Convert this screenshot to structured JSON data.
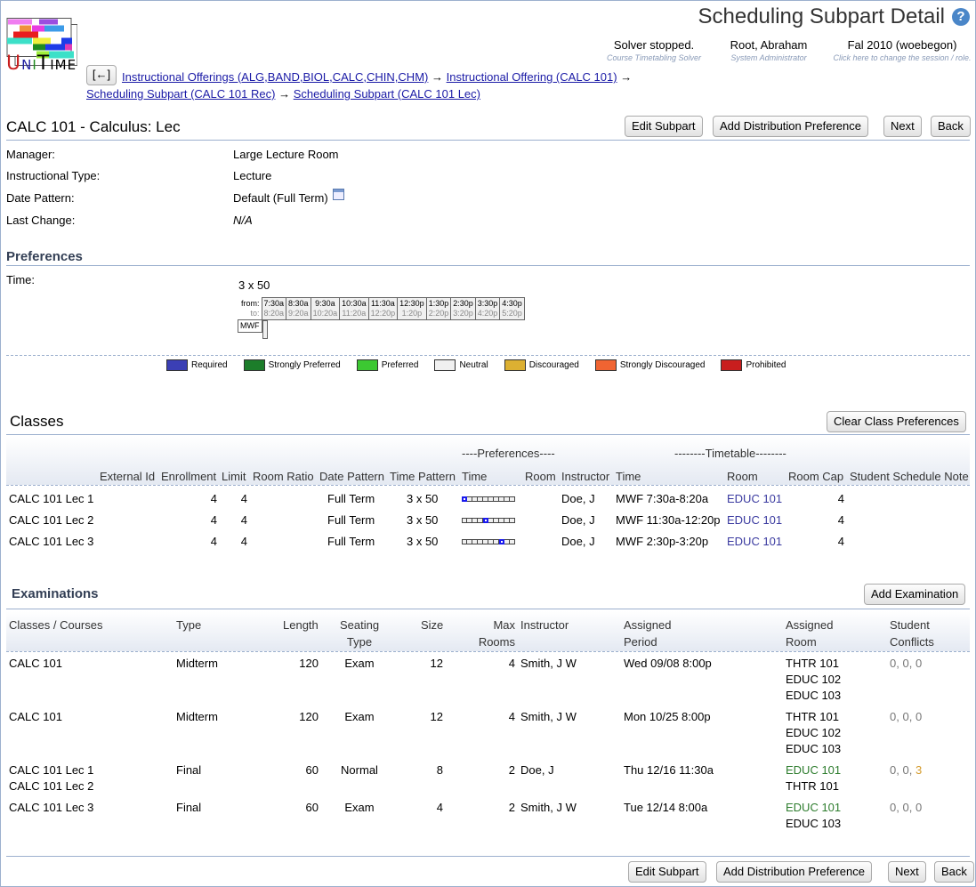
{
  "header": {
    "title": "Scheduling Subpart Detail",
    "help_icon": "question-mark-icon",
    "logo_text": "UniTime",
    "solver": {
      "main": "Solver stopped.",
      "sub": "Course Timetabling Solver"
    },
    "user": {
      "main": "Root, Abraham",
      "sub": "System Administrator"
    },
    "session": {
      "main": "Fal 2010 (woebegon)",
      "sub": "Click here to change the session / role."
    },
    "back_button": "[←]",
    "breadcrumb": [
      "Instructional Offerings (ALG,BAND,BIOL,CALC,CHIN,CHM)",
      "Instructional Offering (CALC 101)",
      "Scheduling Subpart (CALC 101 Rec)",
      "Scheduling Subpart (CALC 101 Lec)"
    ],
    "arrow": "→"
  },
  "subpart": {
    "title": "CALC 101 - Calculus: Lec",
    "buttons": {
      "edit": "Edit Subpart",
      "add_dist": "Add Distribution Preference",
      "next": "Next",
      "back": "Back"
    },
    "properties": [
      {
        "label": "Manager:",
        "value": "Large Lecture Room"
      },
      {
        "label": "Instructional Type:",
        "value": "Lecture"
      },
      {
        "label": "Date Pattern:",
        "value": "Default (Full Term)"
      },
      {
        "label": "Last Change:",
        "value": "N/A"
      }
    ]
  },
  "preferences": {
    "title": "Preferences",
    "time_label": "Time:",
    "pattern": "3 x 50",
    "from_label": "from:",
    "to_label": "to:",
    "slots": [
      {
        "from": "7:30a",
        "to": "8:20a"
      },
      {
        "from": "8:30a",
        "to": "9:20a"
      },
      {
        "from": "9:30a",
        "to": "10:20a"
      },
      {
        "from": "10:30a",
        "to": "11:20a"
      },
      {
        "from": "11:30a",
        "to": "12:20p"
      },
      {
        "from": "12:30p",
        "to": "1:20p"
      },
      {
        "from": "1:30p",
        "to": "2:20p"
      },
      {
        "from": "2:30p",
        "to": "3:20p"
      },
      {
        "from": "3:30p",
        "to": "4:20p"
      },
      {
        "from": "4:30p",
        "to": "5:20p"
      }
    ],
    "days": "MWF",
    "legend": [
      {
        "label": "Required",
        "color": "#3b3fb5"
      },
      {
        "label": "Strongly Preferred",
        "color": "#1c7d2a"
      },
      {
        "label": "Preferred",
        "color": "#3cc832"
      },
      {
        "label": "Neutral",
        "color": "#f0f0f0"
      },
      {
        "label": "Discouraged",
        "color": "#dcb032"
      },
      {
        "label": "Strongly Discouraged",
        "color": "#f06432"
      },
      {
        "label": "Prohibited",
        "color": "#c81e1e"
      }
    ]
  },
  "classes": {
    "title": "Classes",
    "clear_button": "Clear Class Preferences",
    "group_headers": {
      "preferences": "----Preferences----",
      "timetable": "--------Timetable--------"
    },
    "columns": [
      "External Id",
      "Enrollment",
      "Limit",
      "Room Ratio",
      "Date Pattern",
      "Time Pattern",
      "Time",
      "Room",
      "Instructor",
      "Time",
      "Room",
      "Room Cap",
      "Student Schedule Note"
    ],
    "rows": [
      {
        "name": "CALC 101 Lec 1",
        "enrollment": "4",
        "limit": "4",
        "date_pattern": "Full Term",
        "time_pattern": "3 x 50",
        "pref_slot": 0,
        "instructor": "Doe, J",
        "time": "MWF 7:30a-8:20a",
        "room": "EDUC 101",
        "room_cap": "4"
      },
      {
        "name": "CALC 101 Lec 2",
        "enrollment": "4",
        "limit": "4",
        "date_pattern": "Full Term",
        "time_pattern": "3 x 50",
        "pref_slot": 4,
        "instructor": "Doe, J",
        "time": "MWF 11:30a-12:20p",
        "room": "EDUC 101",
        "room_cap": "4"
      },
      {
        "name": "CALC 101 Lec 3",
        "enrollment": "4",
        "limit": "4",
        "date_pattern": "Full Term",
        "time_pattern": "3 x 50",
        "pref_slot": 7,
        "instructor": "Doe, J",
        "time": "MWF 2:30p-3:20p",
        "room": "EDUC 101",
        "room_cap": "4"
      }
    ]
  },
  "examinations": {
    "title": "Examinations",
    "add_button": "Add Examination",
    "columns": {
      "classes": "Classes / Courses",
      "type": "Type",
      "length": "Length",
      "seating_1": "Seating",
      "seating_2": "Type",
      "size": "Size",
      "max_1": "Max",
      "max_2": "Rooms",
      "instructor": "Instructor",
      "period_1": "Assigned",
      "period_2": "Period",
      "room_1": "Assigned",
      "room_2": "Room",
      "conf_1": "Student",
      "conf_2": "Conflicts"
    },
    "rows": [
      {
        "classes": [
          "CALC 101"
        ],
        "type": "Midterm",
        "length": "120",
        "seating": "Exam",
        "size": "12",
        "max_rooms": "4",
        "instructor": "Smith, J W",
        "period": "Wed 09/08 8:00p",
        "rooms": [
          {
            "name": "THTR 101",
            "pref": "none"
          },
          {
            "name": "EDUC 102",
            "pref": "none"
          },
          {
            "name": "EDUC 103",
            "pref": "none"
          }
        ],
        "conflicts": [
          "0",
          "0",
          "0"
        ]
      },
      {
        "classes": [
          "CALC 101"
        ],
        "type": "Midterm",
        "length": "120",
        "seating": "Exam",
        "size": "12",
        "max_rooms": "4",
        "instructor": "Smith, J W",
        "period": "Mon 10/25 8:00p",
        "rooms": [
          {
            "name": "THTR 101",
            "pref": "none"
          },
          {
            "name": "EDUC 102",
            "pref": "none"
          },
          {
            "name": "EDUC 103",
            "pref": "none"
          }
        ],
        "conflicts": [
          "0",
          "0",
          "0"
        ]
      },
      {
        "classes": [
          "CALC 101 Lec 1",
          "CALC 101 Lec 2"
        ],
        "type": "Final",
        "length": "60",
        "seating": "Normal",
        "size": "8",
        "max_rooms": "2",
        "instructor": "Doe, J",
        "period": "Thu 12/16 11:30a",
        "rooms": [
          {
            "name": "EDUC 101",
            "pref": "preferred"
          },
          {
            "name": "THTR 101",
            "pref": "none"
          }
        ],
        "conflicts": [
          "0",
          "0",
          "3"
        ]
      },
      {
        "classes": [
          "CALC 101 Lec 3"
        ],
        "type": "Final",
        "length": "60",
        "seating": "Exam",
        "size": "4",
        "max_rooms": "2",
        "instructor": "Smith, J W",
        "period": "Tue 12/14 8:00a",
        "rooms": [
          {
            "name": "EDUC 101",
            "pref": "preferred"
          },
          {
            "name": "EDUC 103",
            "pref": "none"
          }
        ],
        "conflicts": [
          "0",
          "0",
          "0"
        ]
      }
    ]
  },
  "footer_buttons": {
    "edit": "Edit Subpart",
    "add_dist": "Add Distribution Preference",
    "next": "Next",
    "back": "Back"
  }
}
